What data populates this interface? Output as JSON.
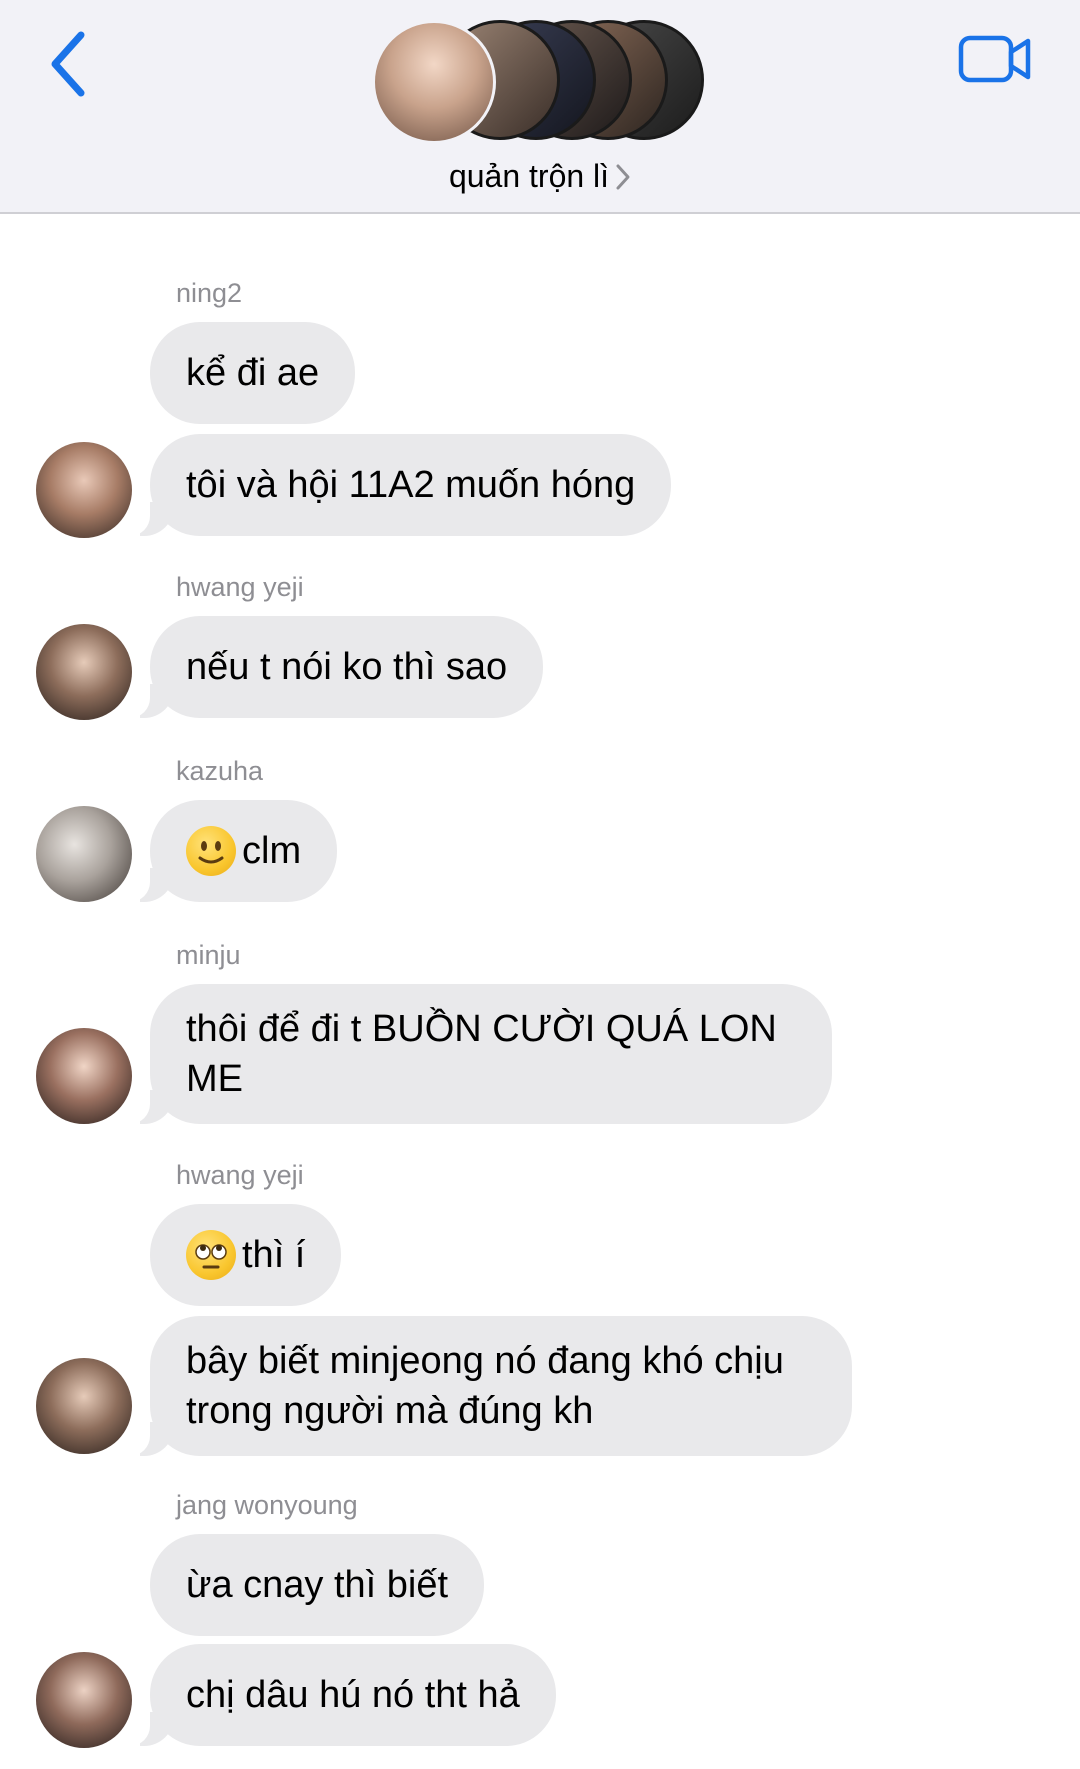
{
  "header": {
    "group_name": "quản trộn lì",
    "back_icon": "chevron-left-icon",
    "video_icon": "video-camera-icon",
    "accent_color": "#1a73e8"
  },
  "messages": [
    {
      "sender": "ning2",
      "bubbles": [
        {
          "text": "kể đi ae"
        },
        {
          "text": "tôi và hội 11A2 muốn hóng"
        }
      ]
    },
    {
      "sender": "hwang yeji",
      "bubbles": [
        {
          "text": "nếu t nói ko thì sao"
        }
      ]
    },
    {
      "sender": "kazuha",
      "bubbles": [
        {
          "emoji": "slightly-smiling-face",
          "text": "clm"
        }
      ]
    },
    {
      "sender": "minju",
      "bubbles": [
        {
          "text": "thôi để đi t BUỒN CƯỜI QUÁ LON ME"
        }
      ]
    },
    {
      "sender": "hwang yeji",
      "bubbles": [
        {
          "emoji": "face-with-rolling-eyes",
          "text": " thì í"
        },
        {
          "text": "bây biết minjeong nó đang khó chịu trong người mà đúng kh"
        }
      ]
    },
    {
      "sender": "jang wonyoung",
      "bubbles": [
        {
          "text": "ừa cnay thì biết"
        },
        {
          "text": "chị dâu hú nó tht hả"
        }
      ]
    }
  ]
}
